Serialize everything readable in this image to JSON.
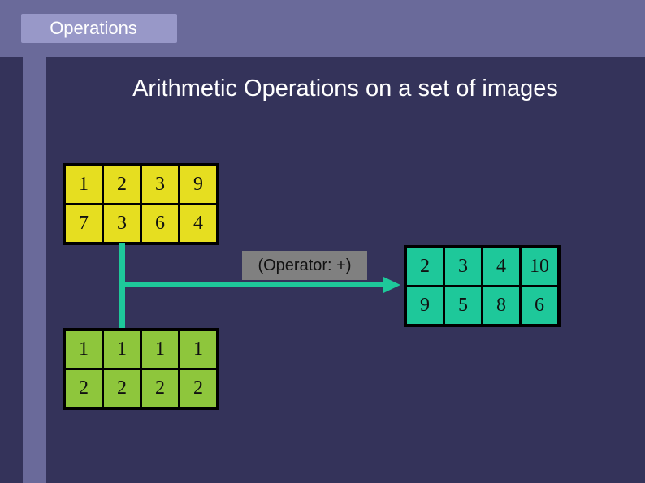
{
  "header": {
    "tab_label": "Operations"
  },
  "slide": {
    "title": "Arithmetic Operations on a set of images"
  },
  "operator_label": "(Operator: +)",
  "colors": {
    "band": "#6a6a9a",
    "tab": "#9898c8",
    "background": "#34335a",
    "image_a": "#e6de20",
    "image_b": "#8ec63c",
    "result": "#1ec89a",
    "connector": "#1ec89a"
  },
  "image_a": {
    "rows": [
      [
        "1",
        "2",
        "3",
        "9"
      ],
      [
        "7",
        "3",
        "6",
        "4"
      ]
    ]
  },
  "image_b": {
    "rows": [
      [
        "1",
        "1",
        "1",
        "1"
      ],
      [
        "2",
        "2",
        "2",
        "2"
      ]
    ]
  },
  "result": {
    "rows": [
      [
        "2",
        "3",
        "4",
        "10"
      ],
      [
        "9",
        "5",
        "8",
        "6"
      ]
    ]
  }
}
